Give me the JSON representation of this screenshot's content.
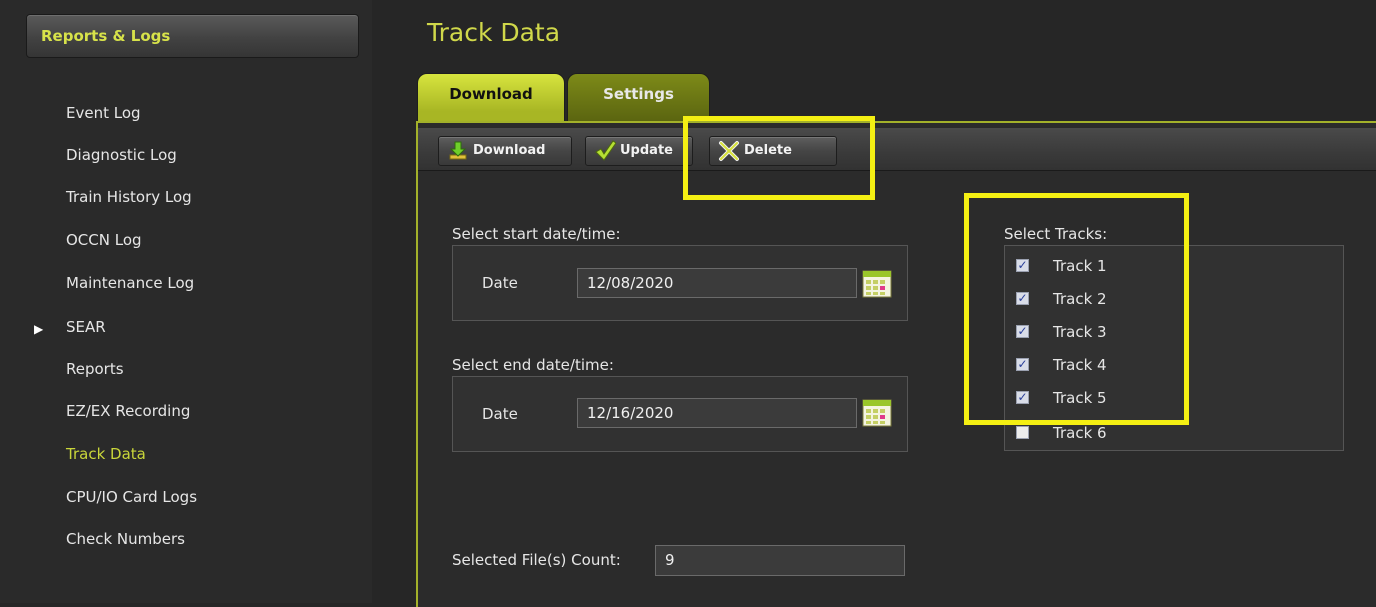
{
  "sidebar": {
    "header": "Reports & Logs",
    "items": [
      {
        "label": "Event Log"
      },
      {
        "label": "Diagnostic Log"
      },
      {
        "label": "Train History Log"
      },
      {
        "label": "OCCN Log"
      },
      {
        "label": "Maintenance Log"
      },
      {
        "label": "SEAR"
      },
      {
        "label": "Reports"
      },
      {
        "label": "EZ/EX Recording"
      },
      {
        "label": "Track Data"
      },
      {
        "label": "CPU/IO Card Logs"
      },
      {
        "label": "Check Numbers"
      }
    ],
    "active_item": "Track Data",
    "expandable_item": "SEAR"
  },
  "page": {
    "title": "Track Data"
  },
  "tabs": [
    {
      "label": "Download",
      "active": true
    },
    {
      "label": "Settings",
      "active": false
    }
  ],
  "toolbar": {
    "download_label": "Download",
    "update_label": "Update",
    "delete_label": "Delete"
  },
  "start": {
    "heading": "Select start date/time:",
    "date_label": "Date",
    "date_value": "12/08/2020"
  },
  "end": {
    "heading": "Select end date/time:",
    "date_label": "Date",
    "date_value": "12/16/2020"
  },
  "tracks": {
    "heading": "Select Tracks:",
    "items": [
      {
        "label": "Track 1",
        "checked": true
      },
      {
        "label": "Track 2",
        "checked": true
      },
      {
        "label": "Track 3",
        "checked": true
      },
      {
        "label": "Track 4",
        "checked": true
      },
      {
        "label": "Track 5",
        "checked": true
      },
      {
        "label": "Track 6",
        "checked": false
      }
    ]
  },
  "file_count": {
    "label": "Selected File(s) Count:",
    "value": "9"
  },
  "colors": {
    "accent": "#d0d84a",
    "tab_active": "#c6d232",
    "tab_inactive": "#6b7714",
    "highlight": "#f4ef13",
    "background": "#262626"
  },
  "icons": {
    "download": "download-arrow-icon",
    "update": "checkmark-icon",
    "delete": "x-icon",
    "calendar": "calendar-icon",
    "nav_expand": "triangle-right-icon"
  }
}
